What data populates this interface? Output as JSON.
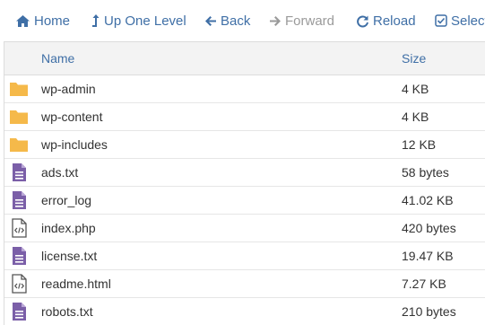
{
  "toolbar": {
    "home_label": "Home",
    "up_label": "Up One Level",
    "back_label": "Back",
    "forward_label": "Forward",
    "reload_label": "Reload",
    "select_label": "Select"
  },
  "table": {
    "columns": {
      "name": "Name",
      "size": "Size"
    },
    "rows": [
      {
        "name": "wp-admin",
        "size": "4 KB",
        "type": "folder-icon"
      },
      {
        "name": "wp-content",
        "size": "4 KB",
        "type": "folder-icon"
      },
      {
        "name": "wp-includes",
        "size": "12 KB",
        "type": "folder-icon"
      },
      {
        "name": "ads.txt",
        "size": "58 bytes",
        "type": "text-file-icon"
      },
      {
        "name": "error_log",
        "size": "41.02 KB",
        "type": "text-file-icon"
      },
      {
        "name": "index.php",
        "size": "420 bytes",
        "type": "code-file-icon"
      },
      {
        "name": "license.txt",
        "size": "19.47 KB",
        "type": "text-file-icon"
      },
      {
        "name": "readme.html",
        "size": "7.27 KB",
        "type": "code-file-icon"
      },
      {
        "name": "robots.txt",
        "size": "210 bytes",
        "type": "text-file-icon"
      }
    ]
  },
  "colors": {
    "link": "#3f6fa6",
    "disabled": "#9a9a9a",
    "folder": "#f5b94a",
    "file": "#7b5fa8",
    "header_bg": "#f3f3f3"
  }
}
